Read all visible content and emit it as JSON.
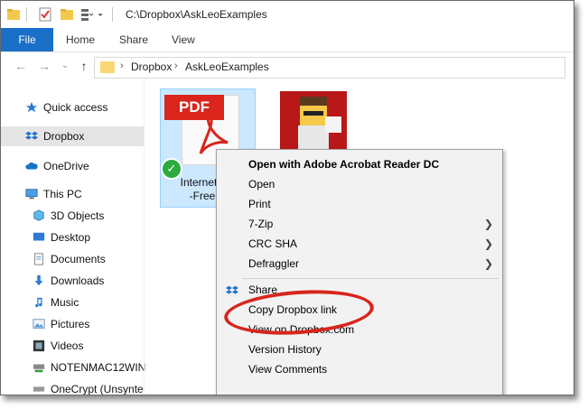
{
  "window": {
    "title": "C:\\Dropbox\\AskLeoExamples"
  },
  "ribbon": {
    "tabs": [
      "File",
      "Home",
      "Share",
      "View"
    ]
  },
  "address": {
    "crumbs": [
      "Dropbox",
      "AskLeoExamples"
    ]
  },
  "sidebar": {
    "items": [
      {
        "label": "Quick access",
        "icon": "star-icon"
      },
      {
        "label": "Dropbox",
        "icon": "dropbox-icon"
      },
      {
        "label": "OneDrive",
        "icon": "cloud-icon"
      },
      {
        "label": "This PC",
        "icon": "computer-icon"
      },
      {
        "label": "3D Objects",
        "icon": "cube-icon"
      },
      {
        "label": "Desktop",
        "icon": "desktop-icon"
      },
      {
        "label": "Documents",
        "icon": "documents-icon"
      },
      {
        "label": "Downloads",
        "icon": "download-icon"
      },
      {
        "label": "Music",
        "icon": "music-icon"
      },
      {
        "label": "Pictures",
        "icon": "pictures-icon"
      },
      {
        "label": "Videos",
        "icon": "video-icon"
      },
      {
        "label": "NOTENMAC12WIN",
        "icon": "network-drive-icon"
      },
      {
        "label": "OneCrypt (Unsynte",
        "icon": "drive-icon"
      }
    ]
  },
  "files": {
    "pdf": {
      "badge": "PDF",
      "name_line1": "InternetSaf",
      "name_line2": "-Free.p"
    }
  },
  "context_menu": {
    "items": [
      {
        "label": "Open with Adobe Acrobat Reader DC"
      },
      {
        "label": "Open"
      },
      {
        "label": "Print"
      },
      {
        "label": "7-Zip"
      },
      {
        "label": "CRC SHA"
      },
      {
        "label": "Defraggler"
      },
      {
        "label": "Share"
      },
      {
        "label": "Copy Dropbox link"
      },
      {
        "label": "View on Dropbox.com"
      },
      {
        "label": "Version History"
      },
      {
        "label": "View Comments"
      }
    ]
  },
  "colors": {
    "file_tab": "#1a6fc9",
    "highlight_ellipse": "#d7261d",
    "selection": "#cce8ff"
  }
}
